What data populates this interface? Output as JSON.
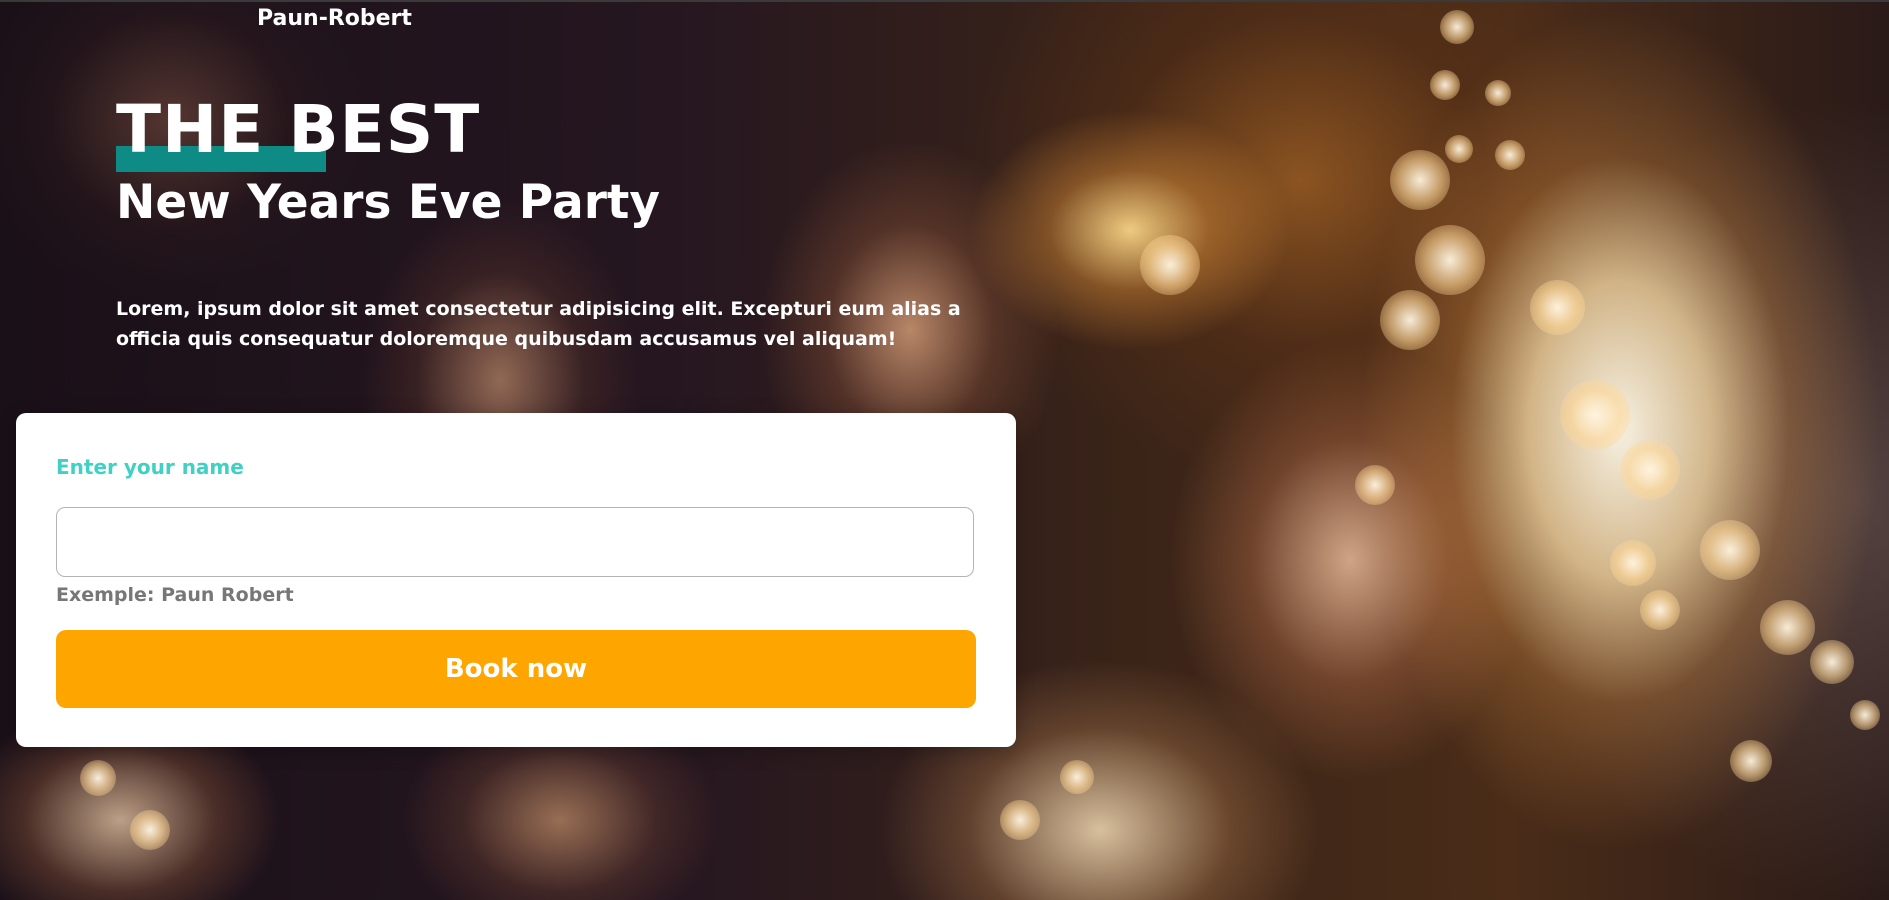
{
  "header": {
    "brand": "Paun-Robert"
  },
  "hero": {
    "title": "THE BEST",
    "subtitle": "New Years Eve Party",
    "description": "Lorem, ipsum dolor sit amet consectetur adipisicing elit. Excepturi eum alias a officia quis consequatur doloremque quibusdam accusamus vel aliquam!"
  },
  "form": {
    "name_label": "Enter your name",
    "name_value": "",
    "name_hint": "Exemple: Paun Robert",
    "submit_label": "Book now"
  },
  "colors": {
    "accent_teal": "#0f8b86",
    "label_teal": "#3fd1c6",
    "button_orange": "#ffa500"
  }
}
